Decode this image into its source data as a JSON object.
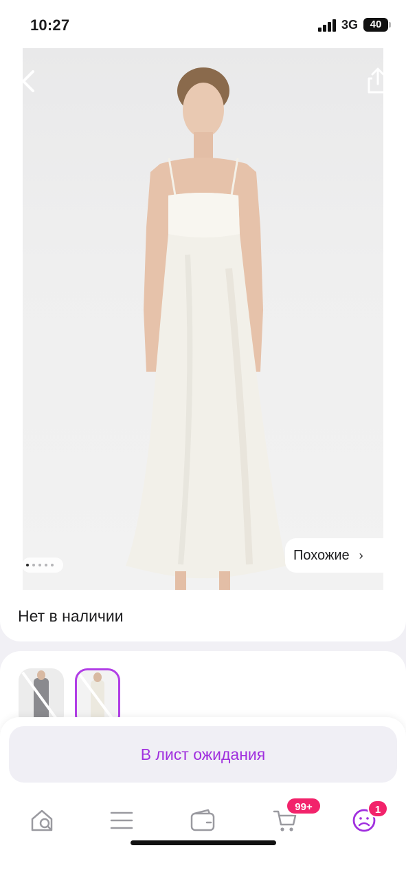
{
  "status_bar": {
    "time": "10:27",
    "network": "3G",
    "battery": "40"
  },
  "product": {
    "image_alt": "white satin slip dress",
    "availability": "Нет в наличии",
    "similar_label": "Похожие",
    "gallery_dots_total": 5,
    "gallery_dot_active": 1,
    "variants_selected_index": 2
  },
  "actions": {
    "waitlist_label": "В лист ожидания"
  },
  "tabbar": {
    "items": [
      {
        "name": "home-search",
        "icon": "home-search-icon"
      },
      {
        "name": "catalog",
        "icon": "menu-lines-icon"
      },
      {
        "name": "wallet",
        "icon": "wallet-icon"
      },
      {
        "name": "cart",
        "icon": "cart-icon",
        "badge": "99+"
      },
      {
        "name": "profile",
        "icon": "profile-icon",
        "badge": "1"
      }
    ]
  },
  "colors": {
    "accent": "#a02fde",
    "badge": "#f2236b",
    "selected_border": "#b13ee6"
  }
}
